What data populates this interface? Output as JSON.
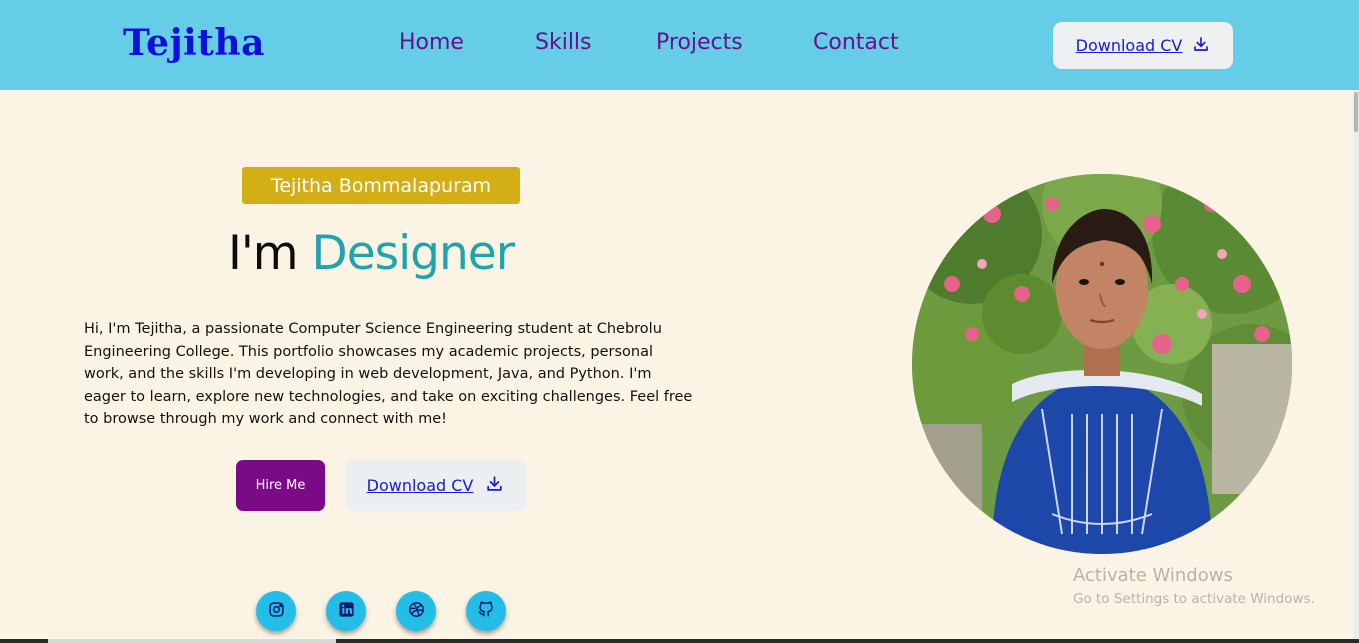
{
  "header": {
    "logo": "Tejitha",
    "nav": [
      "Home",
      "Skills",
      "Projects",
      "Contact"
    ],
    "download_cv": "Download CV"
  },
  "hero": {
    "name_badge": "Tejitha Bommalapuram",
    "headline_prefix": "I'm",
    "headline_role": "Designer",
    "intro": "Hi, I'm Tejitha, a passionate Computer Science Engineering student at Chebrolu Engineering College. This portfolio showcases my academic projects, personal work, and the skills I'm developing in web development, Java, and Python. I'm eager to learn, explore new technologies, and take on exciting challenges. Feel free to browse through my work and connect with me!",
    "hire_button": "Hire Me",
    "download_cv": "Download CV"
  },
  "social": [
    "instagram-icon",
    "linkedin-icon",
    "dribbble-icon",
    "github-icon"
  ],
  "watermark": {
    "title": "Activate Windows",
    "subtitle": "Go to Settings to activate Windows."
  },
  "colors": {
    "header_bg": "#66cde6",
    "page_bg": "#fbf4e5",
    "logo": "#0f0fd8",
    "nav": "#6a0f8e",
    "badge": "#d4ae15",
    "accent": "#22a3ac",
    "hire": "#7a0a85",
    "social": "#23bde8"
  }
}
